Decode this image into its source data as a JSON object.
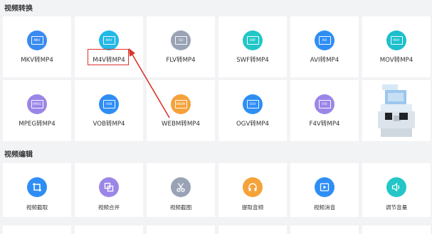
{
  "sections": {
    "conversion_title": "视频转换",
    "editing_title": "视频编辑"
  },
  "conversion": [
    {
      "label": "MKV转MP4",
      "badge": "MKV",
      "color": "#3a8bf0"
    },
    {
      "label": "M4V转MP4",
      "badge": "M4V",
      "color": "#23b8e8"
    },
    {
      "label": "FLV转MP4",
      "badge": "FLV",
      "color": "#9aa3b5"
    },
    {
      "label": "SWF转MP4",
      "badge": "SWF",
      "color": "#22c6c6"
    },
    {
      "label": "AVI转MP4",
      "badge": "AVI",
      "color": "#2f8ef5"
    },
    {
      "label": "MOV转MP4",
      "badge": "MOV",
      "color": "#1cc0cc"
    },
    {
      "label": "MPEG转MP4",
      "badge": "MPEG",
      "color": "#9b86e8"
    },
    {
      "label": "VOB转MP4",
      "badge": "VOB",
      "color": "#2f8ef5"
    },
    {
      "label": "WEBM转MP4",
      "badge": "WEBM",
      "color": "#f5a23a"
    },
    {
      "label": "OGV转MP4",
      "badge": "OGV",
      "color": "#2f8ef5"
    },
    {
      "label": "F4V转MP4",
      "badge": "F4V",
      "color": "#9b86e8"
    }
  ],
  "editing": [
    {
      "label": "视频截取",
      "icon": "crop-icon",
      "color": "#2f8ef5"
    },
    {
      "label": "视频合并",
      "icon": "merge-icon",
      "color": "#9b86e8"
    },
    {
      "label": "视频截图",
      "icon": "scissors-icon",
      "color": "#9aa3b5"
    },
    {
      "label": "提取音频",
      "icon": "headphones-icon",
      "color": "#f5a23a"
    },
    {
      "label": "视频消音",
      "icon": "video-mute-icon",
      "color": "#2f8ef5"
    },
    {
      "label": "调节音量",
      "icon": "volume-icon",
      "color": "#22c6c6"
    }
  ],
  "annotation_color": "#d9332b"
}
